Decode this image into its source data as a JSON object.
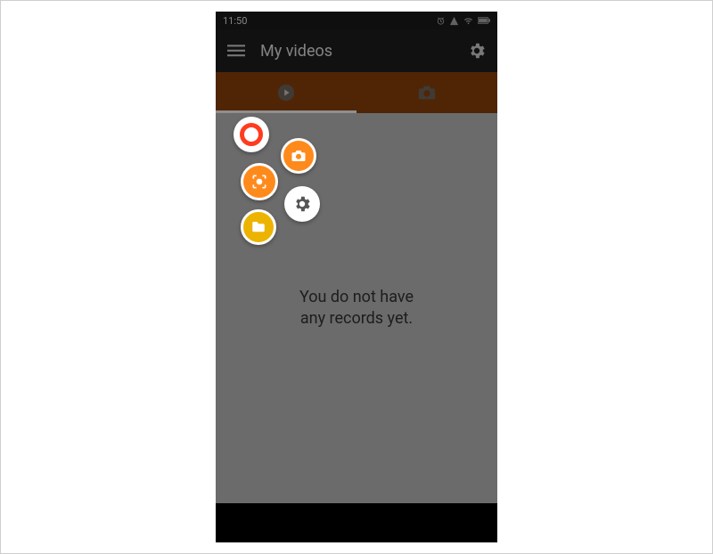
{
  "status_bar": {
    "time": "11:50"
  },
  "app_bar": {
    "title": "My videos"
  },
  "tabs": {
    "videos": "videos",
    "camera": "camera"
  },
  "empty_state": {
    "line1": "You do not have",
    "line2": "any records yet."
  },
  "bubbles": {
    "record": "record",
    "camera": "screenshot",
    "center": "toolbox",
    "settings": "settings",
    "folder": "folder"
  },
  "colors": {
    "accent_orange": "#ff8a1c",
    "tab_bg": "#89400b",
    "record_red": "#ff3c1f",
    "folder_yellow": "#ecb400"
  }
}
